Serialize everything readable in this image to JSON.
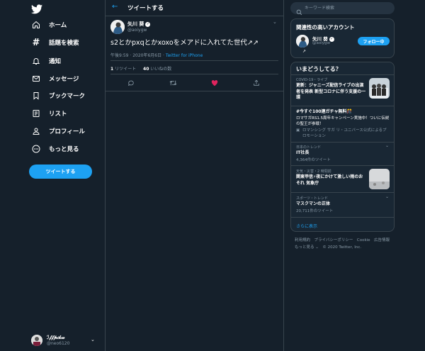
{
  "nav": {
    "items": [
      {
        "label": "ホーム",
        "icon": "home-icon"
      },
      {
        "label": "話題を検索",
        "icon": "hashtag-icon"
      },
      {
        "label": "通知",
        "icon": "bell-icon"
      },
      {
        "label": "メッセージ",
        "icon": "envelope-icon"
      },
      {
        "label": "ブックマーク",
        "icon": "bookmark-icon"
      },
      {
        "label": "リスト",
        "icon": "list-icon"
      },
      {
        "label": "プロフィール",
        "icon": "person-icon"
      },
      {
        "label": "もっと見る",
        "icon": "more-circle-icon"
      }
    ],
    "tweet_button": "ツイートする",
    "account": {
      "name": "ℐ𝒻𝒻𝓅𝒾𝓀𝓌",
      "handle": "@neo6120"
    }
  },
  "main": {
    "header_title": "ツイートする",
    "tweet": {
      "author_name": "矢川 葵",
      "author_handle": "@aoiygw",
      "text": "s2とかpxqとかxoxoをメアドに入れてた世代↗↗",
      "timestamp": "午後9:59 · 2020年6月6日 · ",
      "source": "Twitter for iPhone",
      "retweets_count": "1",
      "retweets_label": " リツイート",
      "likes_count": "40",
      "likes_label": " いいねの数"
    }
  },
  "sidebar": {
    "search_placeholder": "キーワード検索",
    "related": {
      "title": "関連性の高いアカウント",
      "name": "矢川 葵",
      "handle": "@aoiygw",
      "extra": "↗",
      "follow_label": "フォロー中"
    },
    "trends": {
      "title": "いまどうしてる？",
      "items": [
        {
          "meta": "COVID-19・ライブ",
          "title": "更新：ジャニーズ配信ライブの出演者を発表 新型コロナに伴う支援の一環"
        },
        {
          "title": "#今すぐ100連ガチャ無料🎊",
          "body": "ロマサガRS1.5周年キャンペーン実施中！ついに伝説の聖王が参戦！",
          "promo": "ロマンシング サガ リ・ユニバース公式によるプロモーション"
        },
        {
          "meta": "日本のトレンド",
          "title": "IT社長",
          "count": "4,364件のツイート"
        },
        {
          "meta": "天気・災害・2 時間前",
          "title": "関東甲信⚡夜にかけて激しい雨のおそれ 気象庁"
        },
        {
          "meta": "スポーツ・トレンド",
          "title": "マスクマンの正体",
          "count": "20,711件のツイート"
        }
      ],
      "more_label": "さらに表示"
    },
    "footer": {
      "line1": "利用規約　プライバシーポリシー　Cookie　広告情報",
      "line2": "もっと見る ⌄　© 2020 Twitter, Inc."
    }
  },
  "colors": {
    "accent": "#1da1f2",
    "background": "#15202b",
    "card": "#192734",
    "border": "#38444d",
    "muted": "#8899a6",
    "like": "#e0245e"
  }
}
